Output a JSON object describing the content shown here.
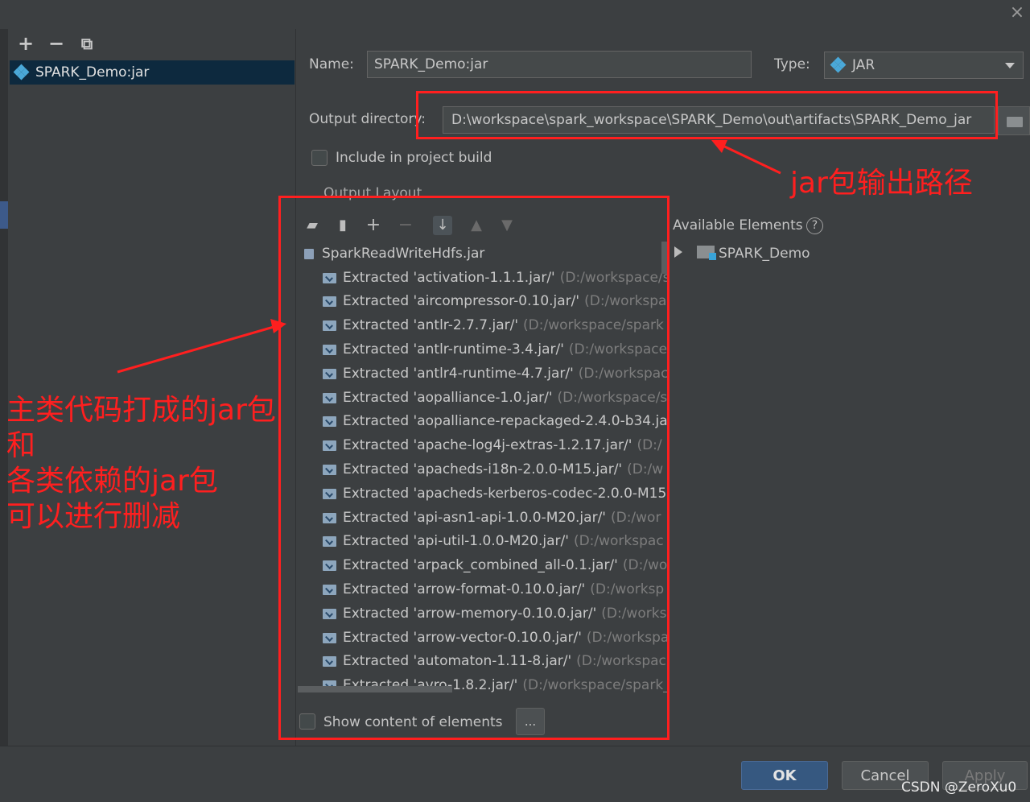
{
  "dialog": {
    "close_label": "×"
  },
  "left": {
    "toolbar": {
      "add": "+",
      "remove": "−",
      "copy": "⧉"
    },
    "artifacts": [
      {
        "label": "SPARK_Demo:jar"
      }
    ]
  },
  "form": {
    "name_label": "Name:",
    "name_value": "SPARK_Demo:jar",
    "type_label": "Type:",
    "type_value": "JAR",
    "output_dir_label": "Output directory:",
    "output_dir_value": "D:\\workspace\\spark_workspace\\SPARK_Demo\\out\\artifacts\\SPARK_Demo_jar",
    "include_build_label": "Include in project build",
    "output_layout_label": "Output Layout"
  },
  "available": {
    "title": "Available Elements",
    "help": "?",
    "items": [
      {
        "label": "SPARK_Demo"
      }
    ]
  },
  "tree": {
    "root": "SparkReadWriteHdfs.jar",
    "rows": [
      {
        "text": "Extracted 'activation-1.1.1.jar/'",
        "path": "(D:/workspace/s"
      },
      {
        "text": "Extracted 'aircompressor-0.10.jar/'",
        "path": "(D:/workspa"
      },
      {
        "text": "Extracted 'antlr-2.7.7.jar/'",
        "path": "(D:/workspace/spark"
      },
      {
        "text": "Extracted 'antlr-runtime-3.4.jar/'",
        "path": "(D:/workspace"
      },
      {
        "text": "Extracted 'antlr4-runtime-4.7.jar/'",
        "path": "(D:/workspac"
      },
      {
        "text": "Extracted 'aopalliance-1.0.jar/'",
        "path": "(D:/workspace/s"
      },
      {
        "text": "Extracted 'aopalliance-repackaged-2.4.0-b34.ja",
        "path": ""
      },
      {
        "text": "Extracted 'apache-log4j-extras-1.2.17.jar/'",
        "path": "(D:/"
      },
      {
        "text": "Extracted 'apacheds-i18n-2.0.0-M15.jar/'",
        "path": "(D:/w"
      },
      {
        "text": "Extracted 'apacheds-kerberos-codec-2.0.0-M15",
        "path": ""
      },
      {
        "text": "Extracted 'api-asn1-api-1.0.0-M20.jar/'",
        "path": "(D:/wor"
      },
      {
        "text": "Extracted 'api-util-1.0.0-M20.jar/'",
        "path": "(D:/workspac"
      },
      {
        "text": "Extracted 'arpack_combined_all-0.1.jar/'",
        "path": "(D:/wo"
      },
      {
        "text": "Extracted 'arrow-format-0.10.0.jar/'",
        "path": "(D:/worksp"
      },
      {
        "text": "Extracted 'arrow-memory-0.10.0.jar/'",
        "path": "(D:/works"
      },
      {
        "text": "Extracted 'arrow-vector-0.10.0.jar/'",
        "path": "(D:/workspa"
      },
      {
        "text": "Extracted 'automaton-1.11-8.jar/'",
        "path": "(D:/workspac"
      },
      {
        "text": "Extracted 'avro-1.8.2.jar/'",
        "path": "(D:/workspace/spark_"
      }
    ]
  },
  "show_content_label": "Show content of elements",
  "ellipsis": "...",
  "buttons": {
    "ok": "OK",
    "cancel": "Cancel",
    "apply": "Apply"
  },
  "annotations": {
    "output_path": "jar包输出路径",
    "left_lines": [
      "主类代码打成的jar包",
      "和",
      "各类依赖的jar包",
      "可以进行删减"
    ],
    "watermark": "CSDN @ZeroXu0"
  },
  "colors": {
    "annotation_red": "#ff1f1f",
    "selection": "#0d293e",
    "ok_button": "#365880"
  }
}
